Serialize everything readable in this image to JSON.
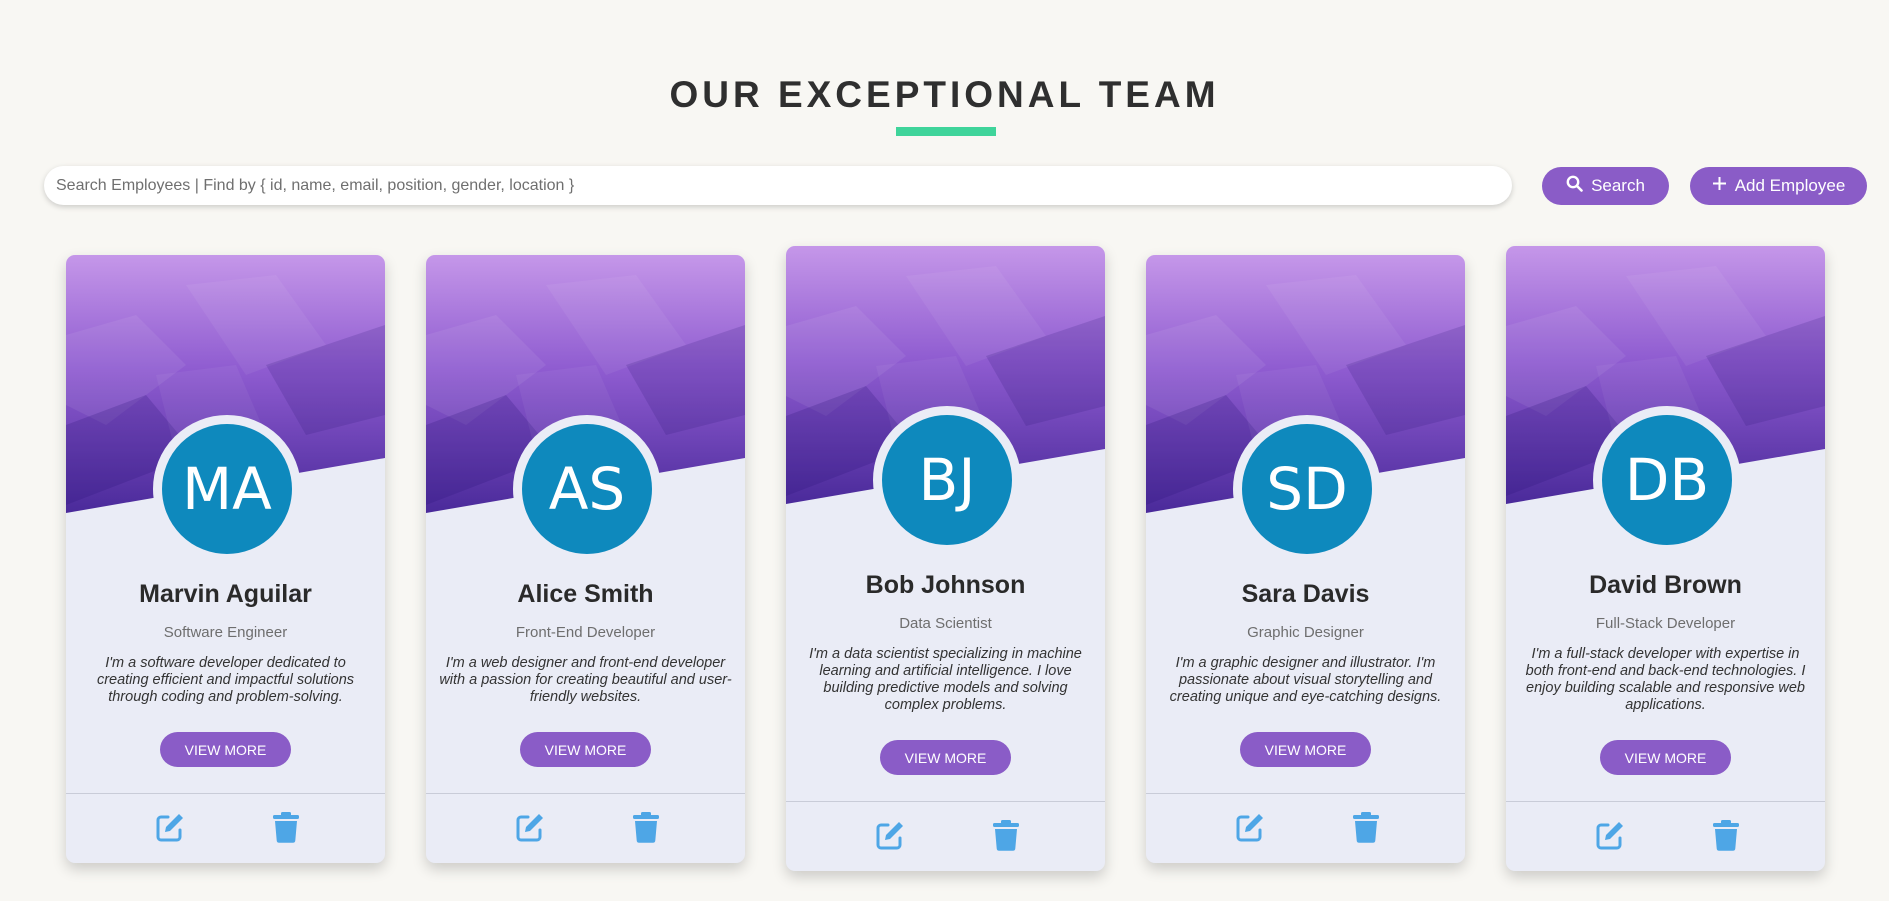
{
  "header": {
    "title": "OUR EXCEPTIONAL TEAM"
  },
  "search": {
    "placeholder": "Search Employees | Find by { id, name, email, position, gender, location }",
    "value": "",
    "button_label": "Search",
    "button_icon": "search-icon"
  },
  "add_employee": {
    "label": "Add Employee",
    "icon": "plus-icon"
  },
  "colors": {
    "background": "#f8f7f3",
    "accent_purple": "#8a5cc7",
    "underline_green": "#3fd49a",
    "avatar_blue": "#0e89bd",
    "action_icon_blue": "#4ea6e6",
    "card_background": "#eaecf6"
  },
  "employees": [
    {
      "initials": "MA",
      "name": "Marvin Aguilar",
      "position": "Software Engineer",
      "bio": "I'm a software developer dedicated to creating efficient and impactful solutions through coding and problem-solving.",
      "view_more_label": "VIEW MORE"
    },
    {
      "initials": "AS",
      "name": "Alice Smith",
      "position": "Front-End Developer",
      "bio": "I'm a web designer and front-end developer with a passion for creating beautiful and user-friendly websites.",
      "view_more_label": "VIEW MORE"
    },
    {
      "initials": "BJ",
      "name": "Bob Johnson",
      "position": "Data Scientist",
      "bio": "I'm a data scientist specializing in machine learning and artificial intelligence. I love building predictive models and solving complex problems.",
      "view_more_label": "VIEW MORE"
    },
    {
      "initials": "SD",
      "name": "Sara Davis",
      "position": "Graphic Designer",
      "bio": "I'm a graphic designer and illustrator. I'm passionate about visual storytelling and creating unique and eye-catching designs.",
      "view_more_label": "VIEW MORE"
    },
    {
      "initials": "DB",
      "name": "David Brown",
      "position": "Full-Stack Developer",
      "bio": "I'm a full-stack developer with expertise in both front-end and back-end technologies. I enjoy building scalable and responsive web applications.",
      "view_more_label": "VIEW MORE"
    }
  ],
  "card_actions": {
    "edit_icon": "edit-icon",
    "delete_icon": "trash-icon"
  }
}
